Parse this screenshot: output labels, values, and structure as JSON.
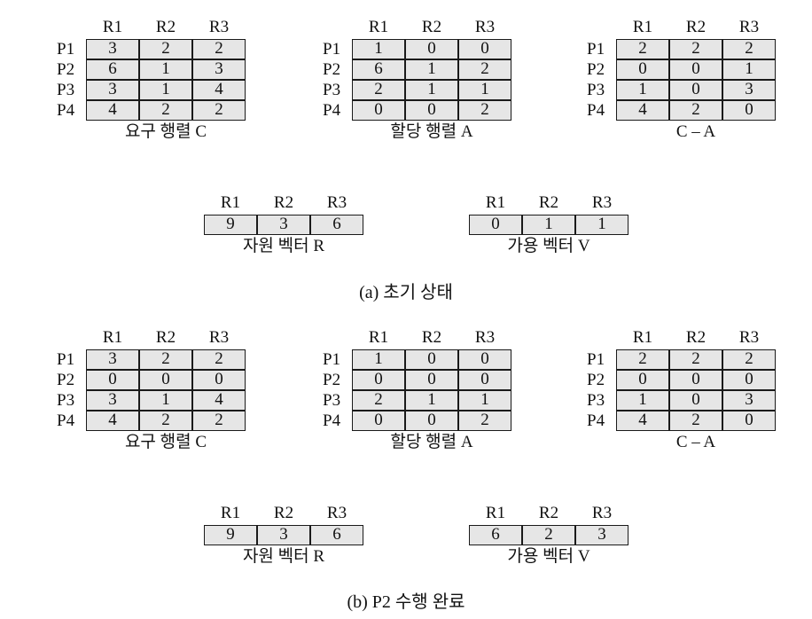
{
  "col_headers": [
    "R1",
    "R2",
    "R3"
  ],
  "row_headers": [
    "P1",
    "P2",
    "P3",
    "P4"
  ],
  "a": {
    "caption": "(a) 초기 상태",
    "claim": {
      "label": "요구 행렬 C",
      "values": [
        [
          "3",
          "2",
          "2"
        ],
        [
          "6",
          "1",
          "3"
        ],
        [
          "3",
          "1",
          "4"
        ],
        [
          "4",
          "2",
          "2"
        ]
      ]
    },
    "alloc": {
      "label": "할당 행렬 A",
      "values": [
        [
          "1",
          "0",
          "0"
        ],
        [
          "6",
          "1",
          "2"
        ],
        [
          "2",
          "1",
          "1"
        ],
        [
          "0",
          "0",
          "2"
        ]
      ]
    },
    "diff": {
      "label": "C – A",
      "values": [
        [
          "2",
          "2",
          "2"
        ],
        [
          "0",
          "0",
          "1"
        ],
        [
          "1",
          "0",
          "3"
        ],
        [
          "4",
          "2",
          "0"
        ]
      ]
    },
    "resource": {
      "label": "자원 벡터 R",
      "values": [
        "9",
        "3",
        "6"
      ]
    },
    "available": {
      "label": "가용 벡터 V",
      "values": [
        "0",
        "1",
        "1"
      ]
    }
  },
  "b": {
    "caption": "(b) P2 수행 완료",
    "claim": {
      "label": "요구 행렬 C",
      "values": [
        [
          "3",
          "2",
          "2"
        ],
        [
          "0",
          "0",
          "0"
        ],
        [
          "3",
          "1",
          "4"
        ],
        [
          "4",
          "2",
          "2"
        ]
      ]
    },
    "alloc": {
      "label": "할당 행렬 A",
      "values": [
        [
          "1",
          "0",
          "0"
        ],
        [
          "0",
          "0",
          "0"
        ],
        [
          "2",
          "1",
          "1"
        ],
        [
          "0",
          "0",
          "2"
        ]
      ]
    },
    "diff": {
      "label": "C – A",
      "values": [
        [
          "2",
          "2",
          "2"
        ],
        [
          "0",
          "0",
          "0"
        ],
        [
          "1",
          "0",
          "3"
        ],
        [
          "4",
          "2",
          "0"
        ]
      ]
    },
    "resource": {
      "label": "자원 벡터 R",
      "values": [
        "9",
        "3",
        "6"
      ]
    },
    "available": {
      "label": "가용 벡터 V",
      "values": [
        "6",
        "2",
        "3"
      ]
    }
  }
}
